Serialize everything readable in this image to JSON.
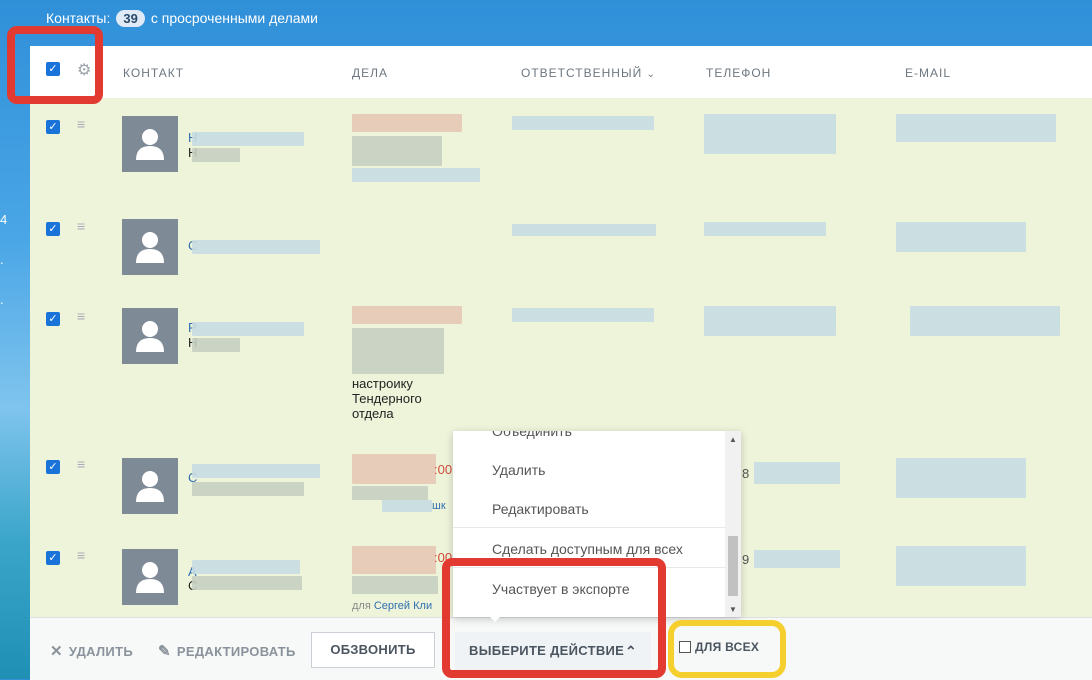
{
  "header": {
    "contacts_label": "Контакты:",
    "contacts_count": "39",
    "filter_text": "с просроченными делами"
  },
  "left_strip": [
    "4",
    ".",
    "."
  ],
  "table": {
    "columns": {
      "contact": "КОНТАКТ",
      "tasks": "ДЕЛА",
      "responsible": "ОТВЕТСТВЕННЫЙ",
      "phone": "ТЕЛЕФОН",
      "email": "E-MAIL"
    }
  },
  "rows": [
    {
      "initial": "Н",
      "initial2": "Н"
    },
    {
      "initial": "С"
    },
    {
      "initial": "Р",
      "initial2": "Н",
      "note": [
        "настроику",
        "Тендерного",
        "отдела"
      ]
    },
    {
      "initial": "С",
      "overdue": ":00",
      "phone_digit": "8",
      "link_suffix": "шк"
    },
    {
      "initial": "А",
      "initial2": "С",
      "overdue": ":00",
      "phone_digit": "9",
      "small_prefix": "для",
      "small_link": "Сергей Кли"
    }
  ],
  "dropdown": {
    "items": [
      "Объединить",
      "Удалить",
      "Редактировать",
      "Сделать доступным для всех",
      "Участвует в экспорте"
    ]
  },
  "footer": {
    "delete_label": "УДАЛИТЬ",
    "edit_label": "РЕДАКТИРОВАТЬ",
    "call_label": "ОБЗВОНИТЬ",
    "action_label": "ВЫБЕРИТЕ ДЕЙСТВИЕ",
    "for_all_label": "ДЛЯ ВСЕХ"
  },
  "colors": {
    "accent": "#1a73d9",
    "highlight_red": "#e23a30",
    "highlight_yellow": "#f5cf2e"
  }
}
